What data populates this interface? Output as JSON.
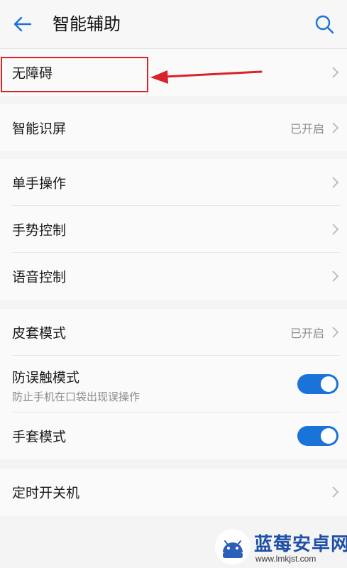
{
  "header": {
    "title": "智能辅助",
    "back_icon": "arrow-left-icon",
    "search_icon": "search-icon"
  },
  "groups": [
    {
      "rows": [
        {
          "label": "无障碍",
          "has_chevron": true
        }
      ]
    },
    {
      "rows": [
        {
          "label": "智能识屏",
          "value": "已开启",
          "has_chevron": true
        }
      ]
    },
    {
      "rows": [
        {
          "label": "单手操作",
          "has_chevron": true
        },
        {
          "label": "手势控制",
          "has_chevron": true
        },
        {
          "label": "语音控制",
          "has_chevron": true
        }
      ]
    },
    {
      "rows": [
        {
          "label": "皮套模式",
          "value": "已开启",
          "has_chevron": true
        },
        {
          "label": "防误触模式",
          "sublabel": "防止手机在口袋出现误操作",
          "toggle": "on"
        },
        {
          "label": "手套模式",
          "toggle": "on"
        }
      ]
    },
    {
      "rows": [
        {
          "label": "定时开关机",
          "has_chevron": true
        }
      ]
    }
  ],
  "colors": {
    "accent": "#1a73d9",
    "annotation": "#d8232a"
  },
  "watermark": {
    "title": "蓝莓安卓网",
    "url": "www.lmkjst.com"
  }
}
